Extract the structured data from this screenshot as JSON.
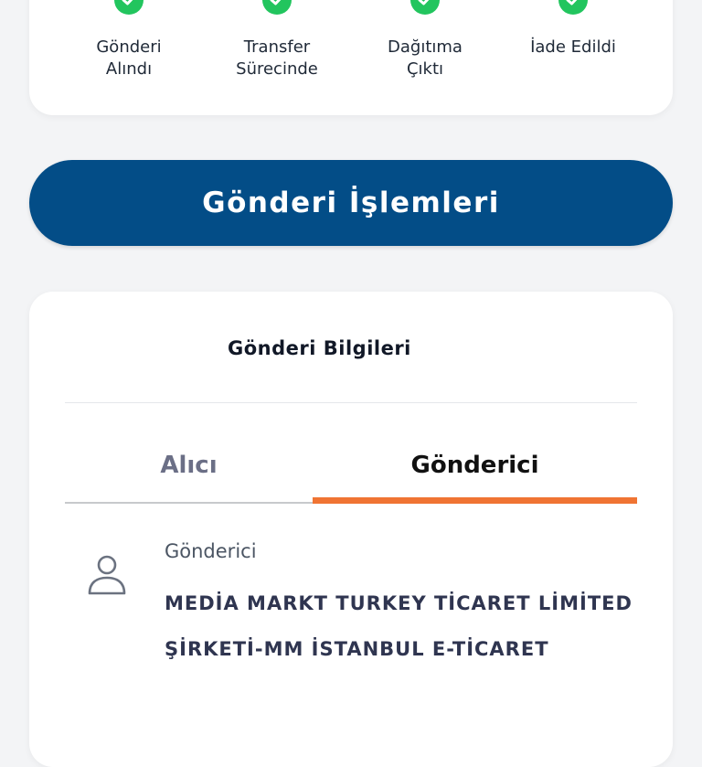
{
  "tracking": {
    "steps": [
      {
        "line1": "Gönderi",
        "line2": "Alındı"
      },
      {
        "line1": "Transfer",
        "line2": "Sürecinde"
      },
      {
        "line1": "Dağıtıma",
        "line2": "Çıktı"
      },
      {
        "line1": "İade Edildi",
        "line2": ""
      }
    ],
    "check_color": "#22c55e"
  },
  "actions": {
    "button_label": "Gönderi İşlemleri",
    "button_color": "#034d87"
  },
  "info": {
    "title": "Gönderi Bilgileri",
    "tabs": [
      {
        "label": "Alıcı",
        "active": false
      },
      {
        "label": "Gönderici",
        "active": true
      }
    ],
    "active_tab_color": "#f07433",
    "sender": {
      "icon": "person-icon",
      "label": "Gönderici",
      "value_line1": "MEDİA MARKT TURKEY TİCARET LİMİTED",
      "value_line2": "ŞİRKETİ-MM İSTANBUL E-TİCARET"
    }
  }
}
